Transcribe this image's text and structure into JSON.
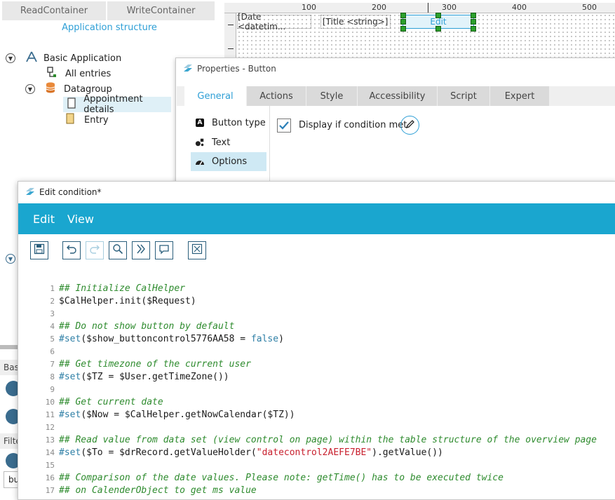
{
  "left_panel": {
    "tabs": [
      "ReadContainer",
      "WriteContainer"
    ],
    "section_title": "Application structure",
    "tree": [
      {
        "label": "Basic Application",
        "icon": "app-icon"
      },
      {
        "label": "All entries",
        "icon": "view-icon"
      },
      {
        "label": "Datagroup",
        "icon": "database-icon"
      },
      {
        "label": "Appointment details",
        "icon": "page-icon"
      },
      {
        "label": "Entry",
        "icon": "form-icon"
      }
    ],
    "cut_labels": {
      "basic": "Bas",
      "filter": "Filte",
      "input": "bu"
    }
  },
  "canvas": {
    "ruler_marks": [
      "100",
      "200",
      "300",
      "400",
      "500"
    ],
    "fields": [
      "[Date <datetim...",
      "[Title <string>]",
      "Edit"
    ]
  },
  "properties": {
    "title": "Properties - Button",
    "tabs": [
      "General",
      "Actions",
      "Style",
      "Accessibility",
      "Script",
      "Expert"
    ],
    "active_tab": "General",
    "options": [
      {
        "label": "Button type",
        "icon": "letter-a-icon"
      },
      {
        "label": "Text",
        "icon": "text-icon"
      },
      {
        "label": "Options",
        "icon": "gauge-icon"
      }
    ],
    "checkbox_label": "Display if condition met"
  },
  "editor": {
    "title": "Edit condition*",
    "menu": [
      "Edit",
      "View"
    ],
    "accent": "#1aa6cf",
    "code": [
      {
        "n": "1",
        "parts": [
          {
            "t": "## Initialize CalHelper",
            "c": "cmt"
          }
        ]
      },
      {
        "n": "2",
        "parts": [
          {
            "t": "$CalHelper.init($Request)",
            "c": "plain"
          }
        ]
      },
      {
        "n": "3",
        "parts": []
      },
      {
        "n": "4",
        "parts": [
          {
            "t": "## Do not show button by default",
            "c": "cmt"
          }
        ]
      },
      {
        "n": "5",
        "parts": [
          {
            "t": "#set",
            "c": "kw"
          },
          {
            "t": "($show_buttoncontrol5776AA58 = ",
            "c": "plain"
          },
          {
            "t": "false",
            "c": "kw"
          },
          {
            "t": ")",
            "c": "plain"
          }
        ]
      },
      {
        "n": "6",
        "parts": []
      },
      {
        "n": "7",
        "parts": [
          {
            "t": "## Get timezone of the current user",
            "c": "cmt"
          }
        ]
      },
      {
        "n": "8",
        "parts": [
          {
            "t": "#set",
            "c": "kw"
          },
          {
            "t": "($TZ = $User.getTimeZone())",
            "c": "plain"
          }
        ]
      },
      {
        "n": "9",
        "parts": []
      },
      {
        "n": "10",
        "parts": [
          {
            "t": "## Get current date",
            "c": "cmt"
          }
        ]
      },
      {
        "n": "11",
        "parts": [
          {
            "t": "#set",
            "c": "kw"
          },
          {
            "t": "($Now = $CalHelper.getNowCalendar($TZ))",
            "c": "plain"
          }
        ]
      },
      {
        "n": "12",
        "parts": []
      },
      {
        "n": "13",
        "parts": [
          {
            "t": "## Read value from data set (view control on page) within the table structure of the overview page",
            "c": "cmt"
          }
        ]
      },
      {
        "n": "14",
        "parts": [
          {
            "t": "#set",
            "c": "kw"
          },
          {
            "t": "($To = $drRecord.getValueHolder(",
            "c": "plain"
          },
          {
            "t": "\"datecontrol2AEFE7BE\"",
            "c": "str"
          },
          {
            "t": ").getValue())",
            "c": "plain"
          }
        ]
      },
      {
        "n": "15",
        "parts": []
      },
      {
        "n": "16",
        "parts": [
          {
            "t": "## Comparison of the date values. Please note: getTime() has to be executed twice",
            "c": "cmt"
          }
        ]
      },
      {
        "n": "17",
        "parts": [
          {
            "t": "## on CalenderObject to get ms value",
            "c": "cmt"
          }
        ]
      }
    ]
  }
}
